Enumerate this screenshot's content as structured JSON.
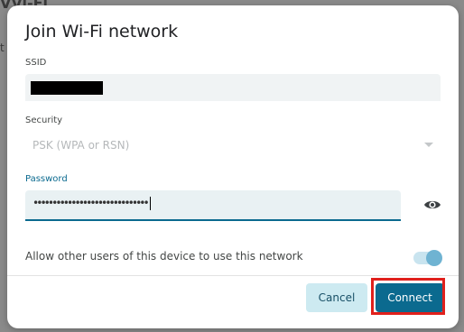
{
  "background": {
    "title_fragment": "VVi-Fi",
    "line_fragment": "t"
  },
  "dialog": {
    "title": "Join Wi-Fi network",
    "ssid": {
      "label": "SSID",
      "value_redacted": true
    },
    "security": {
      "label": "Security",
      "selected": "PSK (WPA or RSN)",
      "disabled": true
    },
    "password": {
      "label": "Password",
      "masked_value": "••••••••••••••••••••••••••••••",
      "visibility_icon": "eye-icon"
    },
    "share_toggle": {
      "label": "Allow other users of this device to use this network",
      "enabled": true
    },
    "buttons": {
      "cancel": "Cancel",
      "connect": "Connect"
    }
  },
  "colors": {
    "accent": "#0b6a8f",
    "highlight": "#e0201c",
    "cancel_bg": "#cdeaf1"
  }
}
